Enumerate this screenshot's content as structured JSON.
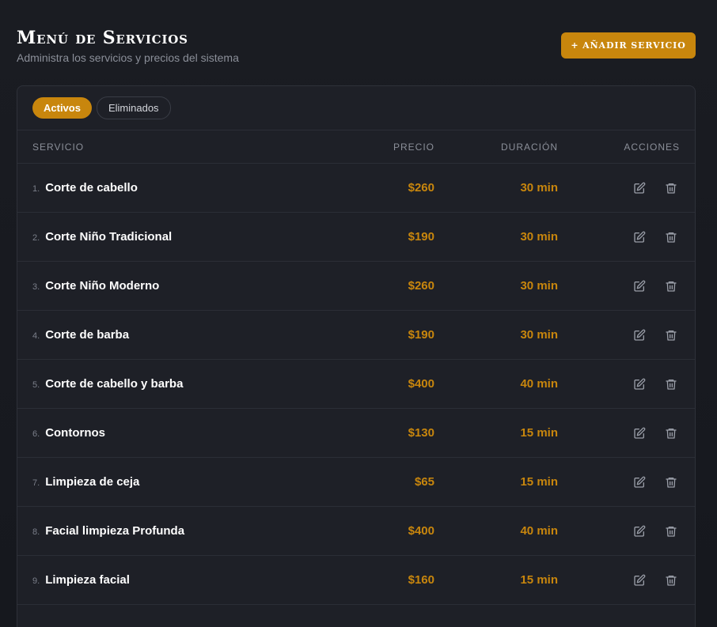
{
  "header": {
    "title": "Menú de Servicios",
    "subtitle": "Administra los servicios y precios del sistema",
    "add_button_label": "+ Añadir Servicio"
  },
  "tabs": [
    {
      "label": "Activos",
      "active": true
    },
    {
      "label": "Eliminados",
      "active": false
    }
  ],
  "table": {
    "columns": [
      "Servicio",
      "Precio",
      "Duración",
      "Acciones"
    ],
    "rows": [
      {
        "num": "1.",
        "name": "Corte de cabello",
        "price": "$260",
        "duration": "30 min"
      },
      {
        "num": "2.",
        "name": "Corte Niño Tradicional",
        "price": "$190",
        "duration": "30 min"
      },
      {
        "num": "3.",
        "name": "Corte Niño Moderno",
        "price": "$260",
        "duration": "30 min"
      },
      {
        "num": "4.",
        "name": "Corte de barba",
        "price": "$190",
        "duration": "30 min"
      },
      {
        "num": "5.",
        "name": "Corte de cabello y barba",
        "price": "$400",
        "duration": "40 min"
      },
      {
        "num": "6.",
        "name": "Contornos",
        "price": "$130",
        "duration": "15 min"
      },
      {
        "num": "7.",
        "name": "Limpieza de ceja",
        "price": "$65",
        "duration": "15 min"
      },
      {
        "num": "8.",
        "name": "Facial limpieza Profunda",
        "price": "$400",
        "duration": "40 min"
      },
      {
        "num": "9.",
        "name": "Limpieza facial",
        "price": "$160",
        "duration": "15 min"
      }
    ],
    "row_icons": [
      "edit-icon",
      "trash-icon"
    ]
  },
  "colors": {
    "accent": "#c8860d",
    "background": "#16181e",
    "card": "#1e2027",
    "border": "#2b2e36",
    "muted_text": "#8b8f99"
  }
}
